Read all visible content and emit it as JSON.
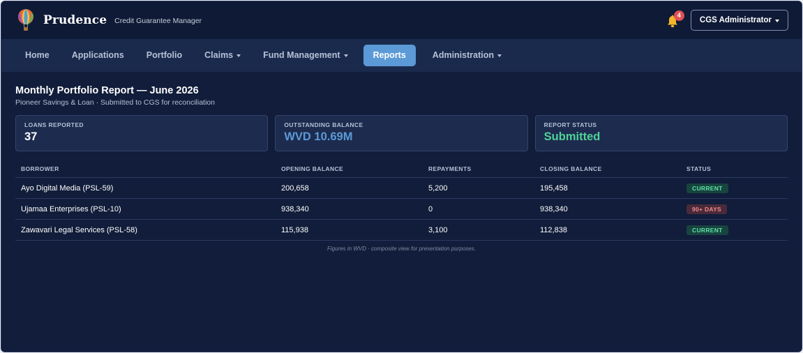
{
  "header": {
    "brand": "Prudence",
    "tagline": "Credit Guarantee Manager",
    "notification_count": "4",
    "user_menu_label": "CGS Administrator"
  },
  "nav": {
    "items": [
      {
        "label": "Home",
        "dropdown": false,
        "active": false
      },
      {
        "label": "Applications",
        "dropdown": false,
        "active": false
      },
      {
        "label": "Portfolio",
        "dropdown": false,
        "active": false
      },
      {
        "label": "Claims",
        "dropdown": true,
        "active": false
      },
      {
        "label": "Fund Management",
        "dropdown": true,
        "active": false
      },
      {
        "label": "Reports",
        "dropdown": false,
        "active": true
      },
      {
        "label": "Administration",
        "dropdown": true,
        "active": false
      }
    ]
  },
  "page": {
    "title": "Monthly Portfolio Report — June 2026",
    "subtitle": "Pioneer Savings & Loan · Submitted to CGS for reconciliation"
  },
  "summary": [
    {
      "label": "LOANS REPORTED",
      "value": "37",
      "color": "#ffffff"
    },
    {
      "label": "OUTSTANDING BALANCE",
      "value": "WVD 10.69M",
      "color": "#5b9ad6"
    },
    {
      "label": "REPORT STATUS",
      "value": "Submitted",
      "color": "#4fd398"
    }
  ],
  "table": {
    "columns": [
      "BORROWER",
      "OPENING BALANCE",
      "REPAYMENTS",
      "CLOSING BALANCE",
      "STATUS"
    ],
    "rows": [
      {
        "borrower": "Ayo Digital Media (PSL-59)",
        "opening": "200,658",
        "repayments": "5,200",
        "closing": "195,458",
        "status": "CURRENT",
        "status_kind": "ok"
      },
      {
        "borrower": "Ujamaa Enterprises (PSL-10)",
        "opening": "938,340",
        "repayments": "0",
        "closing": "938,340",
        "status": "90+ DAYS",
        "status_kind": "overdue"
      },
      {
        "borrower": "Zawavari Legal Services (PSL-58)",
        "opening": "115,938",
        "repayments": "3,100",
        "closing": "112,838",
        "status": "CURRENT",
        "status_kind": "ok"
      }
    ],
    "status_colors": {
      "ok": {
        "bg": "#17443f",
        "fg": "#5fe0a6"
      },
      "overdue": {
        "bg": "#4a2a3a",
        "fg": "#f08a8a"
      }
    }
  },
  "footnote": "Figures in WVD · composite view for presentation purposes."
}
